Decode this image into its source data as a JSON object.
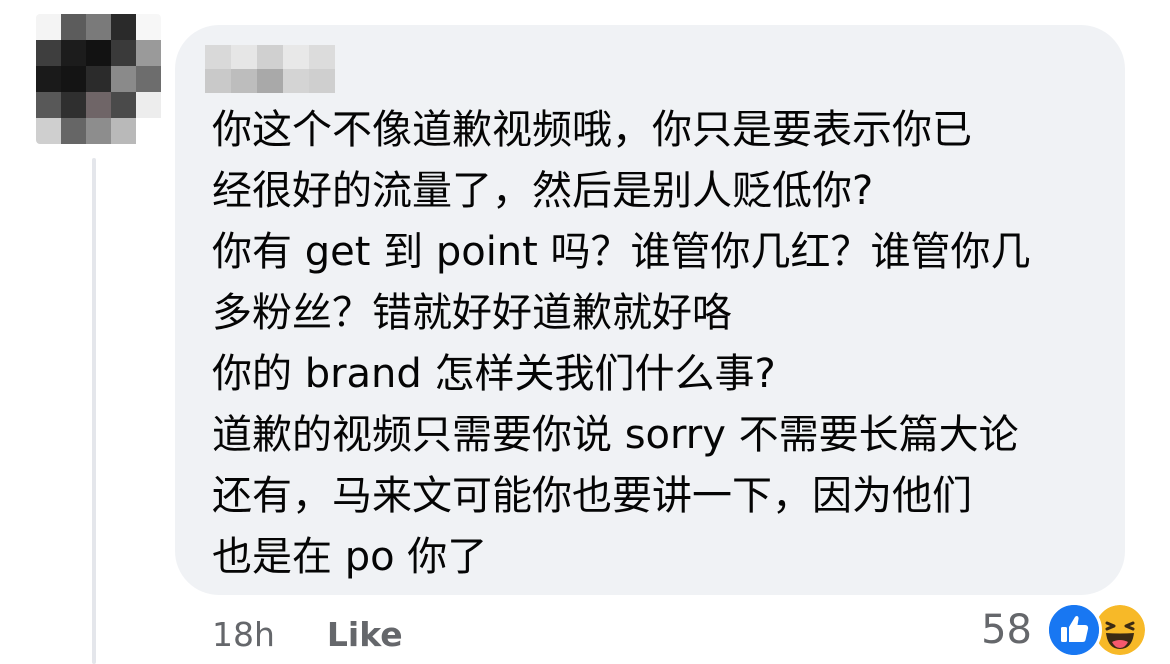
{
  "comment": {
    "lines": [
      "你这个不像道歉视频哦，你只是要表示你已",
      "经很好的流量了，然后是别人贬低你?",
      "你有 get 到 point 吗？谁管你几红？谁管你几",
      "多粉丝？错就好好道歉就好咯",
      "你的 brand 怎样关我们什么事?",
      "道歉的视频只需要你说 sorry 不需要长篇大论",
      "还有，马来文可能你也要讲一下，因为他们",
      "也是在 po 你了"
    ]
  },
  "meta": {
    "timestamp": "18h",
    "like_label": "Like"
  },
  "reactions": {
    "count": "58",
    "icons": [
      "like-reaction-icon",
      "haha-reaction-icon"
    ]
  },
  "colors": {
    "bubble": "#f0f2f5",
    "like_blue": "#1877f2",
    "haha_yellow": "#f7b928",
    "meta_gray": "#65676b"
  }
}
